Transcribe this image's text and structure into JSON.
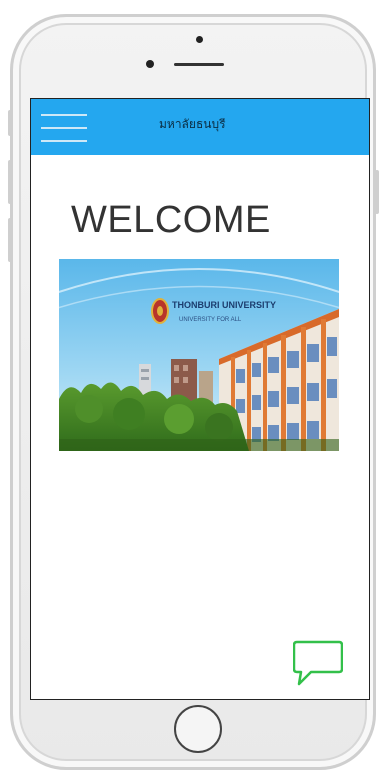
{
  "header": {
    "title": "มหาลัยธนบุรี",
    "menu_icon": "hamburger-menu-icon"
  },
  "main": {
    "welcome_text": "WELCOME",
    "banner": {
      "line1": "THONBURI UNIVERSITY",
      "line2": "UNIVERSITY FOR ALL"
    }
  },
  "chat": {
    "icon": "chat-bubble-icon"
  },
  "colors": {
    "navbar": "#24a7ef",
    "chat_icon": "#33c04a",
    "welcome_text": "#333333"
  }
}
